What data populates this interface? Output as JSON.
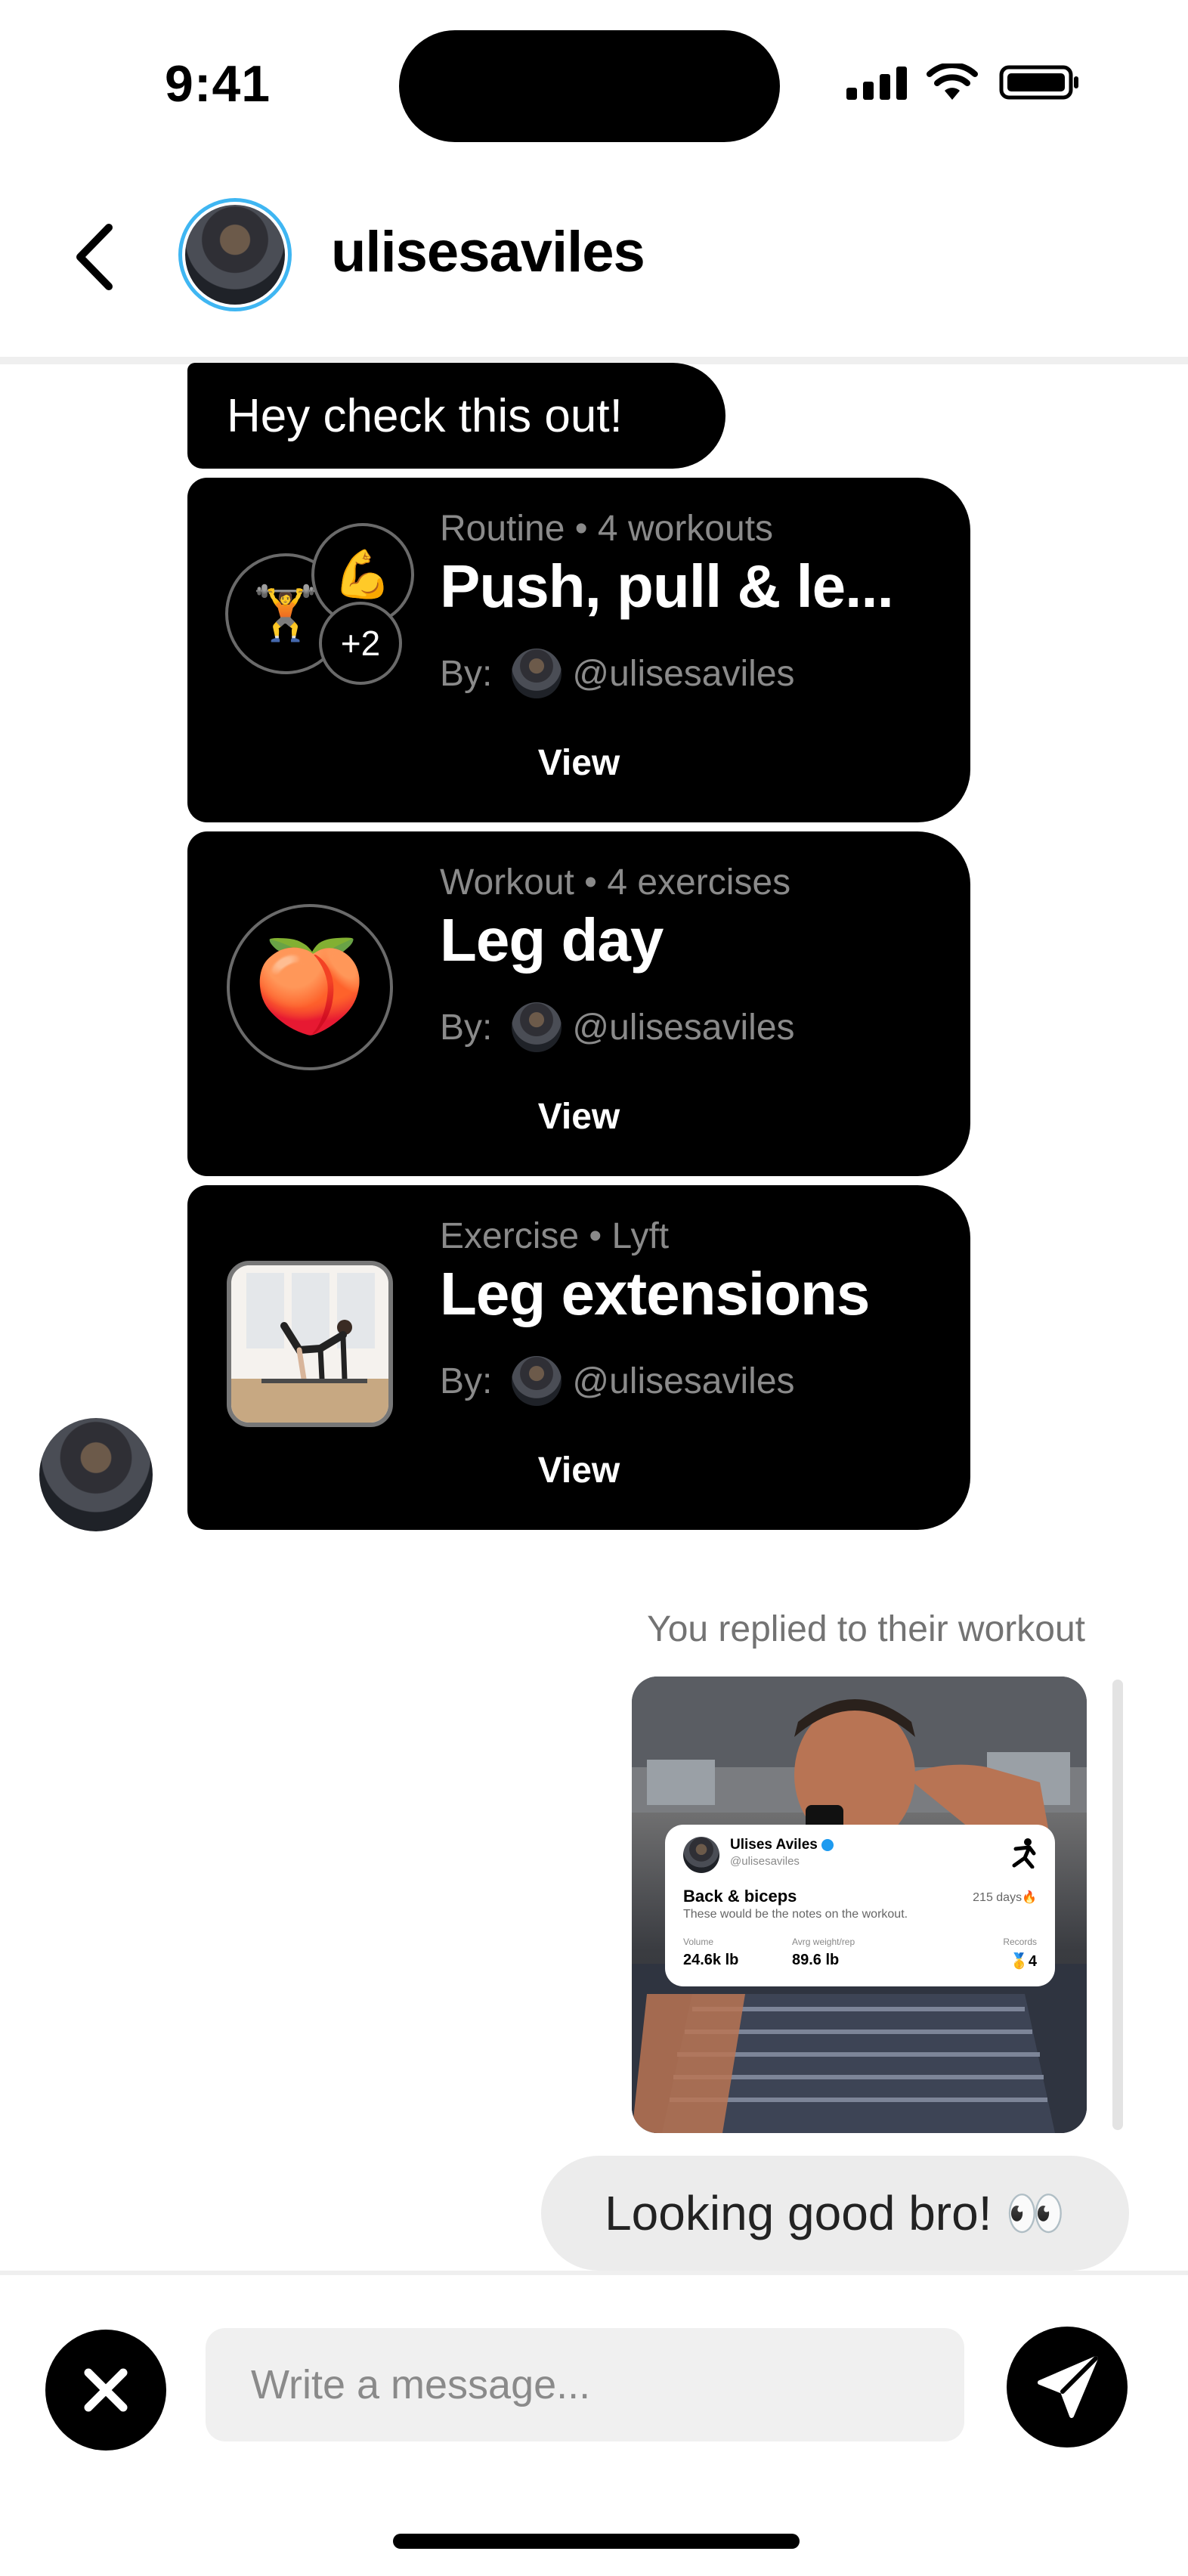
{
  "status_bar": {
    "time": "9:41",
    "icons": [
      "signal-icon",
      "wifi-icon",
      "battery-icon"
    ]
  },
  "header": {
    "username": "ulisesaviles",
    "back_icon": "chevron-left-icon"
  },
  "messages": {
    "text_message": "Hey check this out!",
    "cards": [
      {
        "subtitle": "Routine • 4 workouts",
        "title": "Push, pull & le...",
        "by_label": "By:",
        "handle": "@ulisesaviles",
        "view_label": "View",
        "extra_count": "+2",
        "icons": [
          "weightlifter-emoji",
          "flexed-biceps-emoji"
        ]
      },
      {
        "subtitle": "Workout • 4 exercises",
        "title": "Leg day",
        "by_label": "By:",
        "handle": "@ulisesaviles",
        "view_label": "View",
        "icons": [
          "peach-emoji"
        ]
      },
      {
        "subtitle": "Exercise • Lyft",
        "title": "Leg extensions",
        "by_label": "By:",
        "handle": "@ulisesaviles",
        "view_label": "View",
        "icons": [
          "exercise-photo"
        ]
      }
    ]
  },
  "reply": {
    "label": "You replied to their workout",
    "workout_card": {
      "name": "Ulises Aviles",
      "handle": "@ulisesaviles",
      "title": "Back & biceps",
      "streak": "215 days🔥",
      "notes": "These would be the notes on the workout.",
      "stats": [
        {
          "label": "Volume",
          "value": "24.6k lb"
        },
        {
          "label": "Avrg weight/rep",
          "value": "89.6 lb"
        },
        {
          "label": "Records",
          "value": "🥇4"
        }
      ]
    },
    "message": "Looking good bro! 👀"
  },
  "composer": {
    "placeholder": "Write a message...",
    "value": ""
  },
  "colors": {
    "story_ring": "#3fb6f2",
    "bubble_dark": "#000000",
    "bubble_light": "#ececec"
  }
}
